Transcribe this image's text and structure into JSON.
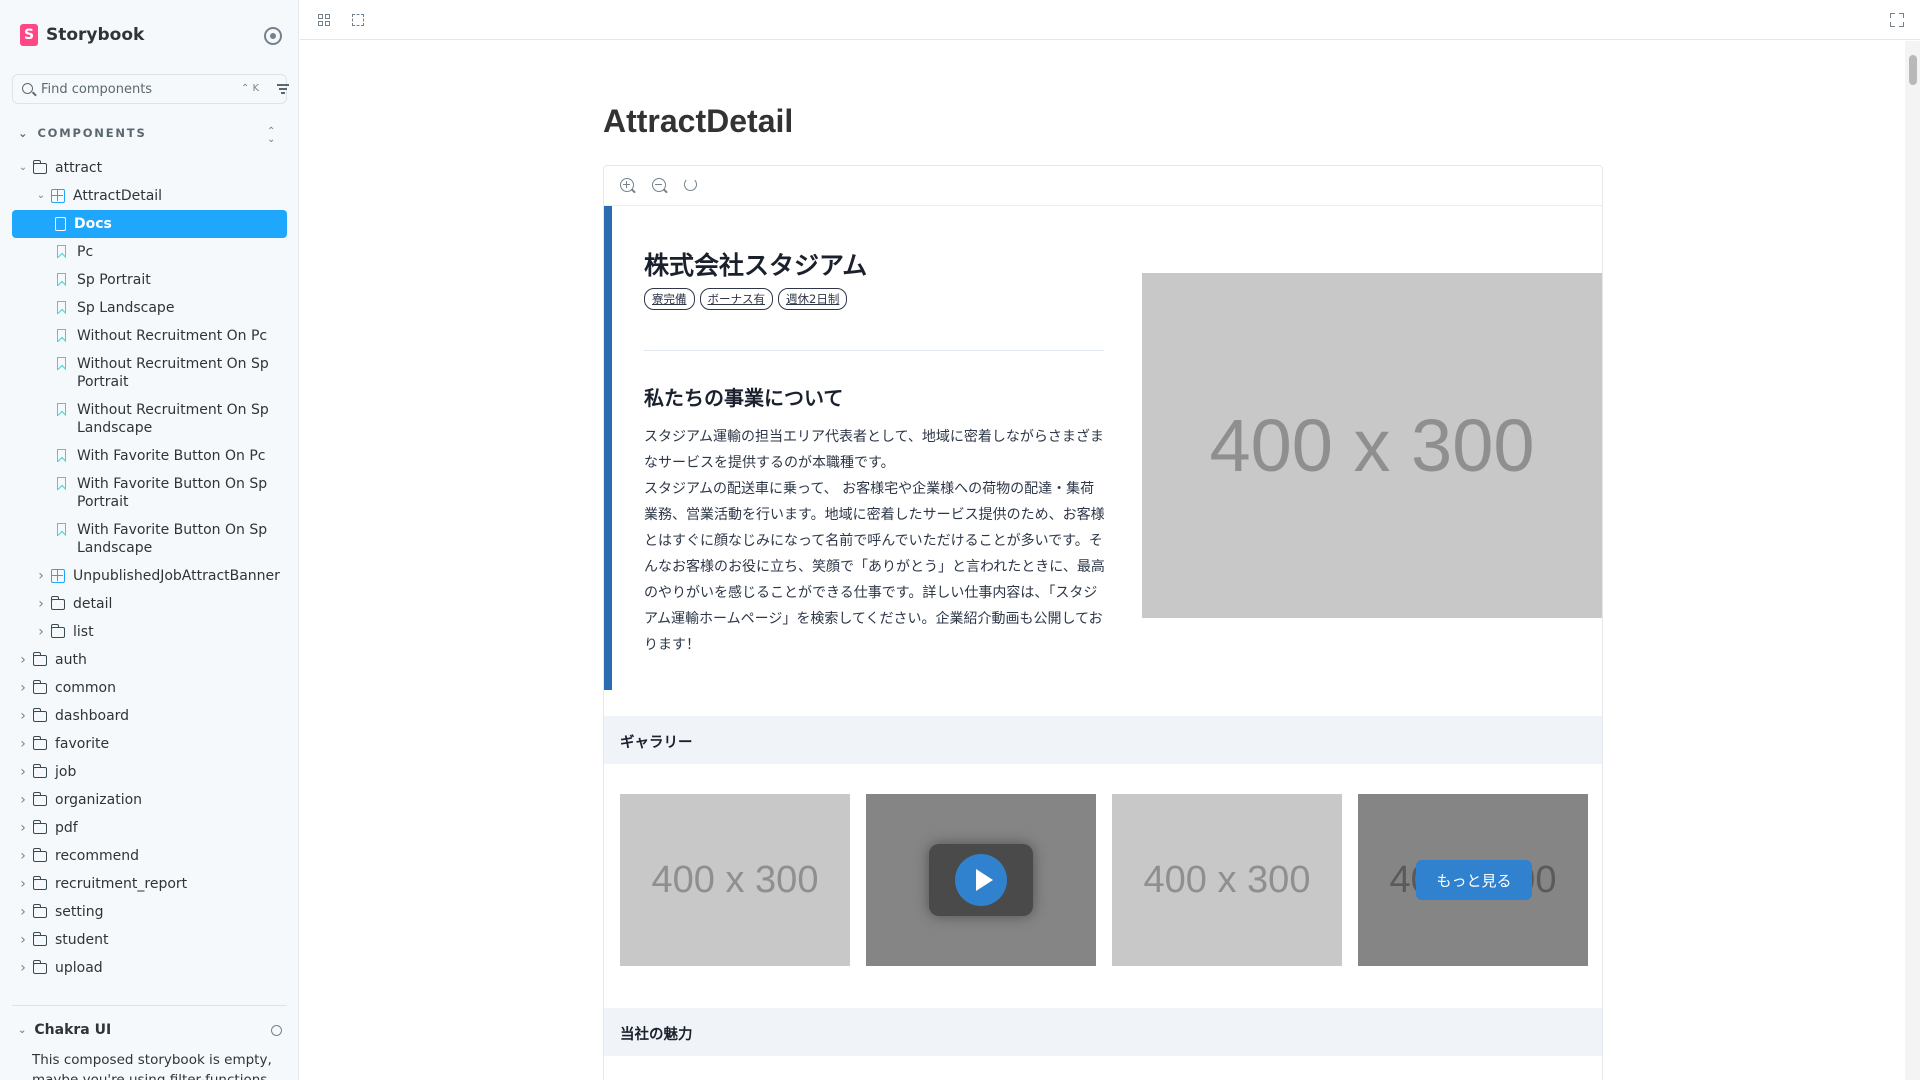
{
  "brand": {
    "name": "Storybook",
    "logo_letter": "S"
  },
  "search": {
    "placeholder": "Find components",
    "shortcut": "⌃ K"
  },
  "sidebar": {
    "section_label": "COMPONENTS",
    "tree": [
      {
        "label": "attract",
        "type": "folder",
        "depth": 0,
        "expanded": true
      },
      {
        "label": "AttractDetail",
        "type": "component",
        "depth": 1,
        "expanded": true
      },
      {
        "label": "Docs",
        "type": "doc",
        "depth": 2,
        "selected": true
      },
      {
        "label": "Pc",
        "type": "story",
        "depth": 2
      },
      {
        "label": "Sp Portrait",
        "type": "story",
        "depth": 2
      },
      {
        "label": "Sp Landscape",
        "type": "story",
        "depth": 2
      },
      {
        "label": "Without Recruitment On Pc",
        "type": "story",
        "depth": 2
      },
      {
        "label": "Without Recruitment On Sp Portrait",
        "type": "story",
        "depth": 2
      },
      {
        "label": "Without Recruitment On Sp Landscape",
        "type": "story",
        "depth": 2
      },
      {
        "label": "With Favorite Button On Pc",
        "type": "story",
        "depth": 2
      },
      {
        "label": "With Favorite Button On Sp Portrait",
        "type": "story",
        "depth": 2
      },
      {
        "label": "With Favorite Button On Sp Landscape",
        "type": "story",
        "depth": 2
      },
      {
        "label": "UnpublishedJobAttractBanner",
        "type": "component",
        "depth": 1,
        "expanded": false
      },
      {
        "label": "detail",
        "type": "folder",
        "depth": 1,
        "expanded": false
      },
      {
        "label": "list",
        "type": "folder",
        "depth": 1,
        "expanded": false
      },
      {
        "label": "auth",
        "type": "folder",
        "depth": 0,
        "expanded": false
      },
      {
        "label": "common",
        "type": "folder",
        "depth": 0,
        "expanded": false
      },
      {
        "label": "dashboard",
        "type": "folder",
        "depth": 0,
        "expanded": false
      },
      {
        "label": "favorite",
        "type": "folder",
        "depth": 0,
        "expanded": false
      },
      {
        "label": "job",
        "type": "folder",
        "depth": 0,
        "expanded": false
      },
      {
        "label": "organization",
        "type": "folder",
        "depth": 0,
        "expanded": false
      },
      {
        "label": "pdf",
        "type": "folder",
        "depth": 0,
        "expanded": false
      },
      {
        "label": "recommend",
        "type": "folder",
        "depth": 0,
        "expanded": false
      },
      {
        "label": "recruitment_report",
        "type": "folder",
        "depth": 0,
        "expanded": false
      },
      {
        "label": "setting",
        "type": "folder",
        "depth": 0,
        "expanded": false
      },
      {
        "label": "student",
        "type": "folder",
        "depth": 0,
        "expanded": false
      },
      {
        "label": "upload",
        "type": "folder",
        "depth": 0,
        "expanded": false
      }
    ],
    "ref": {
      "title": "Chakra UI",
      "text": "This composed storybook is empty, maybe you're using filter-functions"
    }
  },
  "docs": {
    "title": "AttractDetail",
    "company_name": "株式会社スタジアム",
    "tags": [
      "寮完備",
      "ボーナス有",
      "週休2日制"
    ],
    "about_title": "私たちの事業について",
    "about_text": "スタジアム運輸の担当エリア代表者として、地域に密着しながらさまざまなサービスを提供するのが本職種です。\nスタジアムの配送車に乗って、 お客様宅や企業様への荷物の配達・集荷業務、営業活動を行います。地域に密着したサービス提供のため、お客様とはすぐに顔なじみになって名前で呼んでいただけることが多いです。そんなお客様のお役に立ち、笑顔で「ありがとう」と言われたときに、最高のやりがいを感じることができる仕事です。詳しい仕事内容は、「スタジアム運輸ホームページ」を検索してください。企業紹介動画も公開しております！",
    "hero_placeholder": "400 x 300",
    "gallery_title": "ギャラリー",
    "gallery": [
      {
        "kind": "image",
        "text": "400 x 300"
      },
      {
        "kind": "video",
        "text": ""
      },
      {
        "kind": "image",
        "text": "400 x 300"
      },
      {
        "kind": "more",
        "text": "400 x 300",
        "button": "もっと見る"
      }
    ],
    "charm_title": "当社の魅力"
  },
  "colors": {
    "accent": "#1ea7fd",
    "brand": "#ff4785",
    "card_bar": "#2b6cb0",
    "button": "#3182ce"
  }
}
